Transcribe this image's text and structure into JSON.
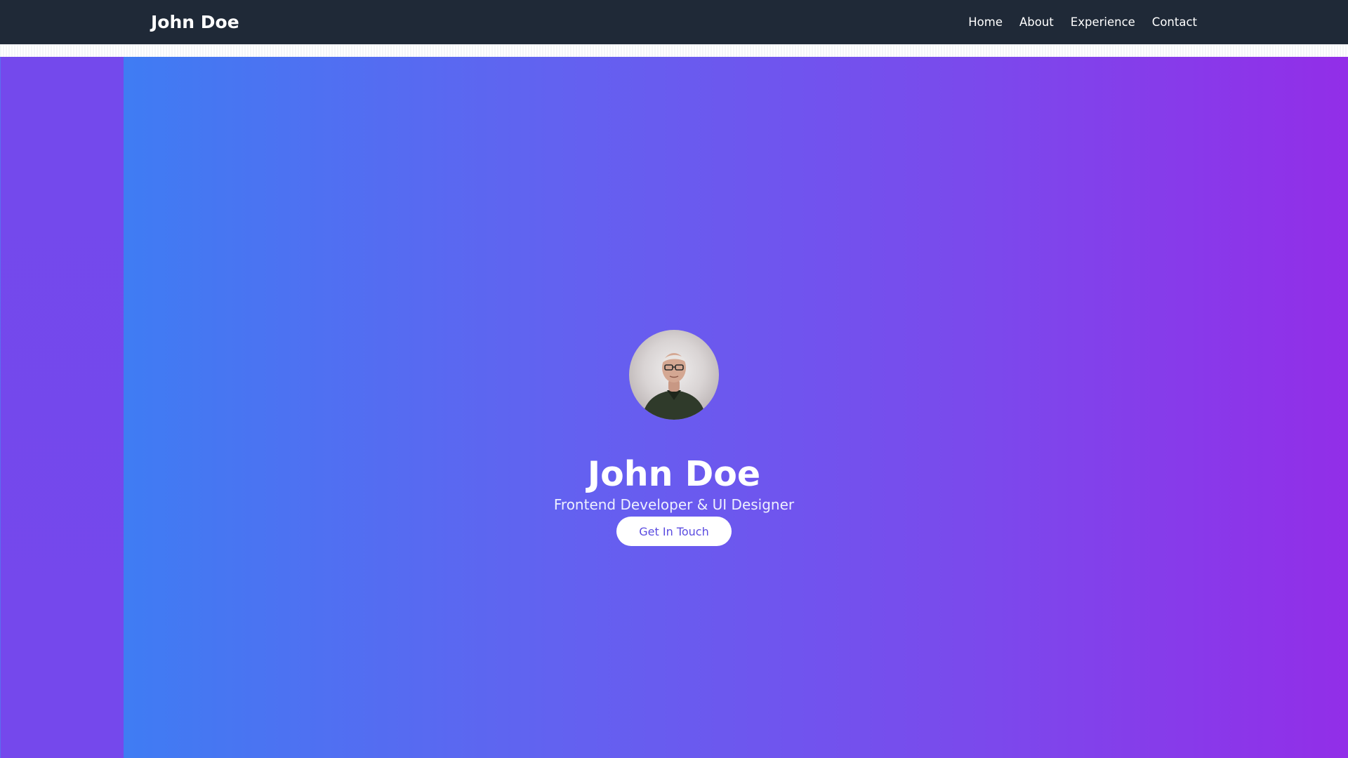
{
  "navbar": {
    "brand": "John Doe",
    "links": [
      {
        "label": "Home"
      },
      {
        "label": "About"
      },
      {
        "label": "Experience"
      },
      {
        "label": "Contact"
      }
    ]
  },
  "hero": {
    "name": "John Doe",
    "subtitle": "Frontend Developer & UI Designer",
    "cta_label": "Get In Touch",
    "gradient_start": "#3f7cf3",
    "gradient_end": "#922ee8"
  },
  "colors": {
    "navbar_bg": "#1f2937",
    "cta_text": "#5a4be0"
  }
}
